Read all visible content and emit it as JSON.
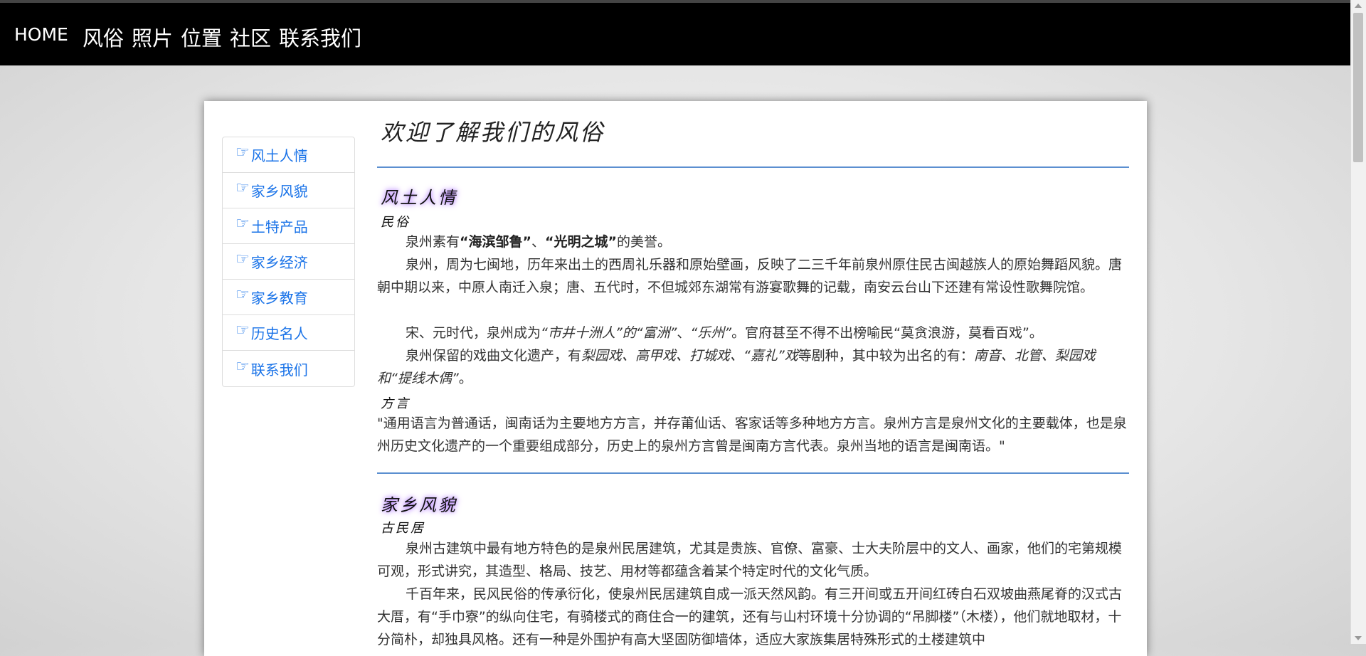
{
  "nav": {
    "home": "HOME",
    "links": [
      "风俗",
      "照片",
      "位置",
      "社区",
      "联系我们"
    ]
  },
  "sidebar": {
    "icon": "pointing-hand-icon",
    "items": [
      "风土人情",
      "家乡风貌",
      "土特产品",
      "家乡经济",
      "家乡教育",
      "历史名人",
      "联系我们"
    ]
  },
  "main": {
    "title": "欢迎了解我们的风俗",
    "section1": {
      "title": "风土人情",
      "sub1": "民俗",
      "p1": {
        "a": "泉州素有",
        "b1": "“海滨邹鲁”",
        "c": "、",
        "b2": "“光明之城”",
        "d": "的美誉。"
      },
      "p2": "泉州，周为七闽地，历年来出土的西周礼乐器和原始壁画，反映了二三千年前泉州原住民古闽越族人的原始舞蹈风貌。唐朝中期以来，中原人南迁入泉；唐、五代时，不但城郊东湖常有游宴歌舞的记载，南安云台山下还建有常设性歌舞院馆。",
      "p3": {
        "a": "宋、元时代，泉州成为",
        "i1": "“市井十洲人”的“富洲”",
        "b": "、",
        "i2": "“乐州”",
        "c": "。官府甚至不得不出榜喻民“莫贪浪游，莫看百戏”。"
      },
      "p4": {
        "a": "泉州保留的戏曲文化遗产，有",
        "i1": "梨园戏、高甲戏、打城戏、“嘉礼”戏",
        "b": "等剧种，其中较为出名的有：",
        "i2": "南音、北管、梨园戏和“提线木偶”",
        "c": "。"
      },
      "sub2": "方言",
      "p5": "\"通用语言为普通话，闽南话为主要地方方言，并存莆仙话、客家话等多种地方方言。泉州方言是泉州文化的主要载体，也是泉州历史文化遗产的一个重要组成部分，历史上的泉州方言曾是闽南方言代表。泉州当地的语言是闽南语。\""
    },
    "section2": {
      "title": "家乡风貌",
      "sub1": "古民居",
      "p1": "泉州古建筑中最有地方特色的是泉州民居建筑，尤其是贵族、官僚、富豪、士大夫阶层中的文人、画家，他们的宅第规模可观，形式讲究，其造型、格局、技艺、用材等都蕴含着某个特定时代的文化气质。",
      "p2": "千百年来，民风民俗的传承衍化，使泉州民居建筑自成一派天然风韵。有三开间或五开间红砖白石双坡曲燕尾脊的汉式古大厝，有“手巾寮”的纵向住宅，有骑楼式的商住合一的建筑，还有与山村环境十分协调的“吊脚楼”（木楼），他们就地取材，十分简朴，却独具风格。还有一种是外围护有高大坚固防御墙体，适应大家族集居特殊形式的土楼建筑中"
    }
  }
}
